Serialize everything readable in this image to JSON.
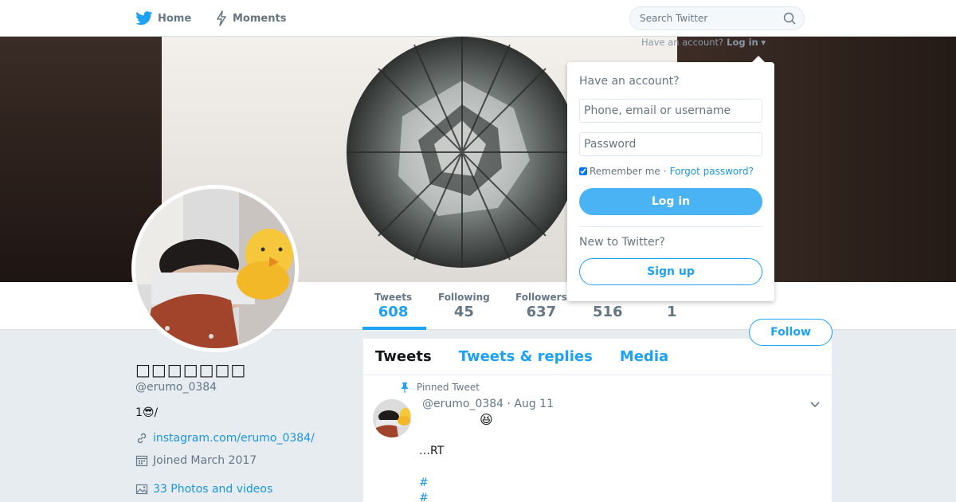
{
  "nav": {
    "home_label": "Home",
    "moments_label": "Moments",
    "search_placeholder": "Search Twitter",
    "have_account_text": "Have an account?",
    "login_link": "Log in",
    "brand_color": "#1da1f2"
  },
  "profile": {
    "display_name": "□□□□□□□",
    "handle": "@erumo_0384",
    "bio_prefix": "1",
    "bio_emoji": "😎",
    "bio_suffix": "/",
    "website": "instagram.com/erumo_0384/",
    "joined": "Joined March 2017",
    "media_link": "33 Photos and videos",
    "follow_label": "Follow"
  },
  "stats": [
    {
      "label": "Tweets",
      "value": "608"
    },
    {
      "label": "Following",
      "value": "45"
    },
    {
      "label": "Followers",
      "value": "637"
    },
    {
      "label": "",
      "value": "516"
    },
    {
      "label": "",
      "value": "1"
    }
  ],
  "timeline": {
    "tabs": [
      "Tweets",
      "Tweets & replies",
      "Media"
    ],
    "pinned_label": "Pinned Tweet",
    "tweet": {
      "handle": "@erumo_0384",
      "date": "· Aug 11",
      "emoji": "😆",
      "text": "…RT",
      "hashtags": [
        "#",
        "#"
      ]
    }
  },
  "login_dropdown": {
    "title": "Have an account?",
    "username_placeholder": "Phone, email or username",
    "password_placeholder": "Password",
    "remember_label": "Remember me",
    "separator": "·",
    "forgot_label": "Forgot password?",
    "login_label": "Log in",
    "new_label": "New to Twitter?",
    "signup_label": "Sign up"
  }
}
